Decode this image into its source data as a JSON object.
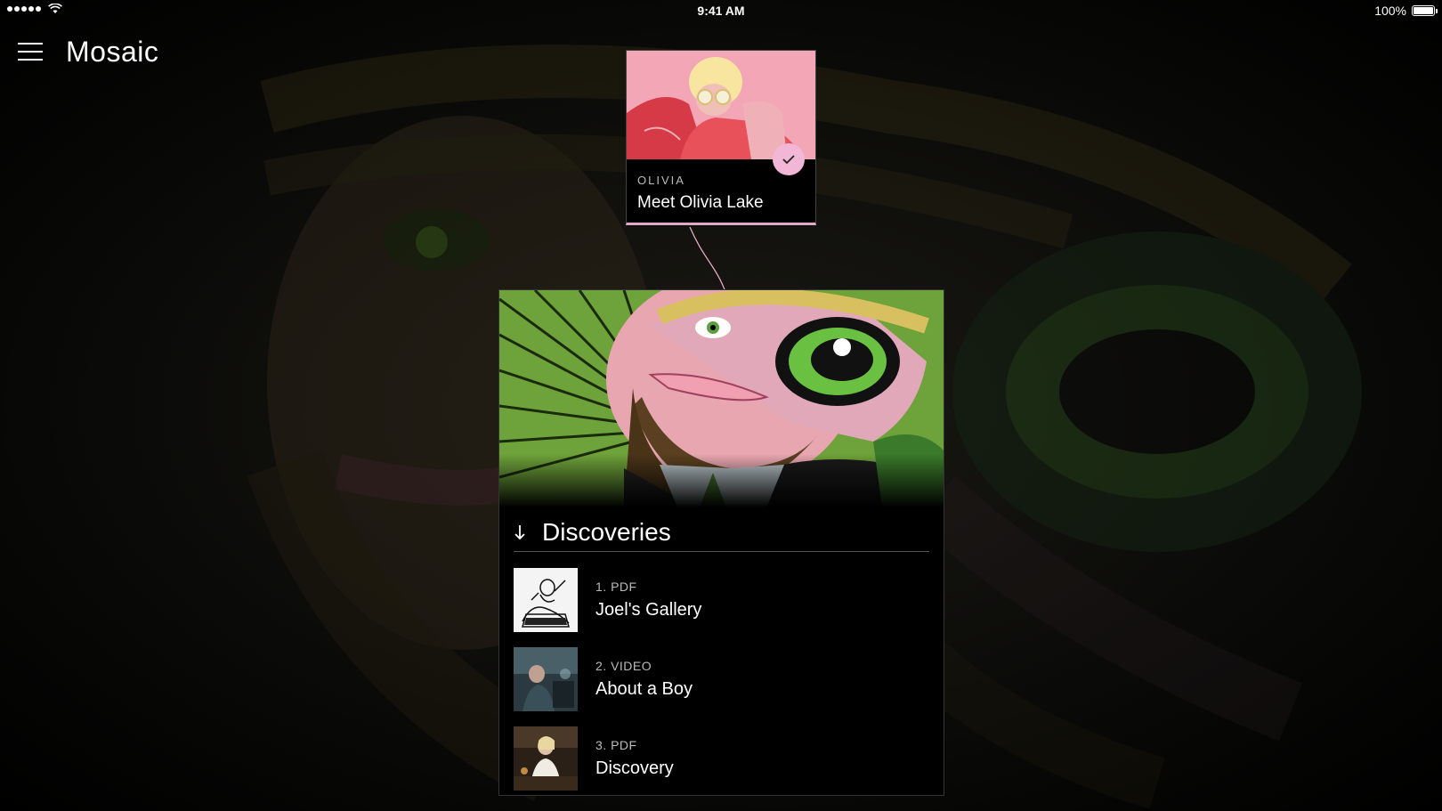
{
  "status_bar": {
    "time": "9:41 AM",
    "battery": "100%",
    "battery_level": 1.0
  },
  "header": {
    "title": "Mosaic",
    "menu_icon": "hamburger-menu-icon"
  },
  "top_card": {
    "eyebrow": "OLIVIA",
    "title": "Meet Olivia Lake",
    "badge_icon": "check-icon",
    "accent_color": "#f2b6d6"
  },
  "panel": {
    "section_title": "Discoveries",
    "section_icon": "arrow-down-icon",
    "items": [
      {
        "meta": "1. PDF",
        "title": "Joel's Gallery"
      },
      {
        "meta": "2. VIDEO",
        "title": "About a Boy"
      },
      {
        "meta": "3. PDF",
        "title": "Discovery"
      }
    ]
  }
}
